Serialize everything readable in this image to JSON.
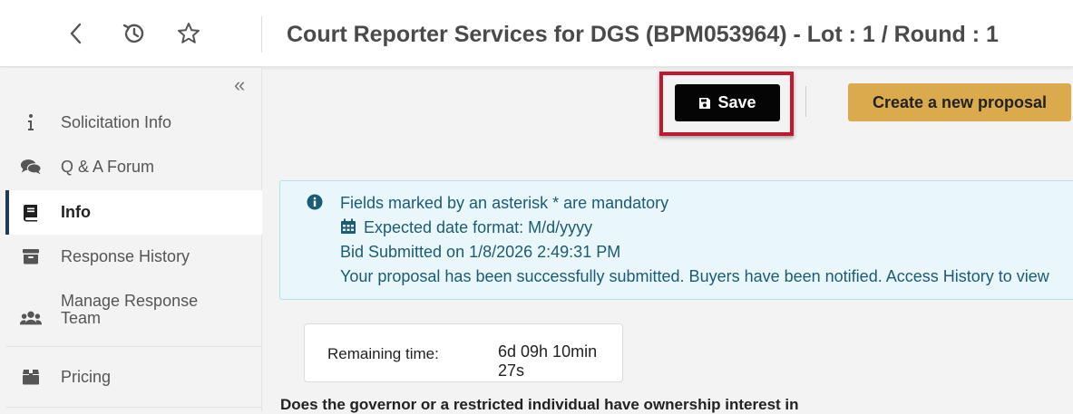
{
  "header": {
    "title": "Court Reporter Services for DGS (BPM053964) - Lot : 1 / Round : 1",
    "icons": [
      "back-arrow-icon",
      "history-icon",
      "star-icon"
    ]
  },
  "sidebar": {
    "collapse_icon": "double-chevron-left-icon",
    "items": [
      {
        "label": "Solicitation Info",
        "icon": "info-icon"
      },
      {
        "label": "Q & A Forum",
        "icon": "comments-icon"
      },
      {
        "label": "Info",
        "icon": "book-icon",
        "active": true
      },
      {
        "label": "Response History",
        "icon": "archive-icon"
      },
      {
        "label": "Manage Response Team",
        "icon": "users-icon"
      },
      {
        "label": "Pricing",
        "icon": "box-icon"
      }
    ]
  },
  "toolbar": {
    "save_label": "Save",
    "create_label": "Create a new proposal"
  },
  "alert": {
    "line1": "Fields marked by an asterisk * are mandatory",
    "line2": "Expected date format: M/d/yyyy",
    "line3": "Bid Submitted on 1/8/2026 2:49:31 PM",
    "line4": "Your proposal has been successfully submitted. Buyers have been notified. Access History to view"
  },
  "timer": {
    "label": "Remaining time:",
    "value": "6d 09h 10min 27s"
  },
  "question": "Does the governor or a restricted individual have ownership interest in",
  "colors": {
    "save_bg": "#050505",
    "create_bg": "#dbaa4c",
    "highlight": "#c0182f",
    "alert_bg": "#eaf7fa",
    "alert_text": "#1b5b74",
    "active_border": "#1d3a56"
  }
}
